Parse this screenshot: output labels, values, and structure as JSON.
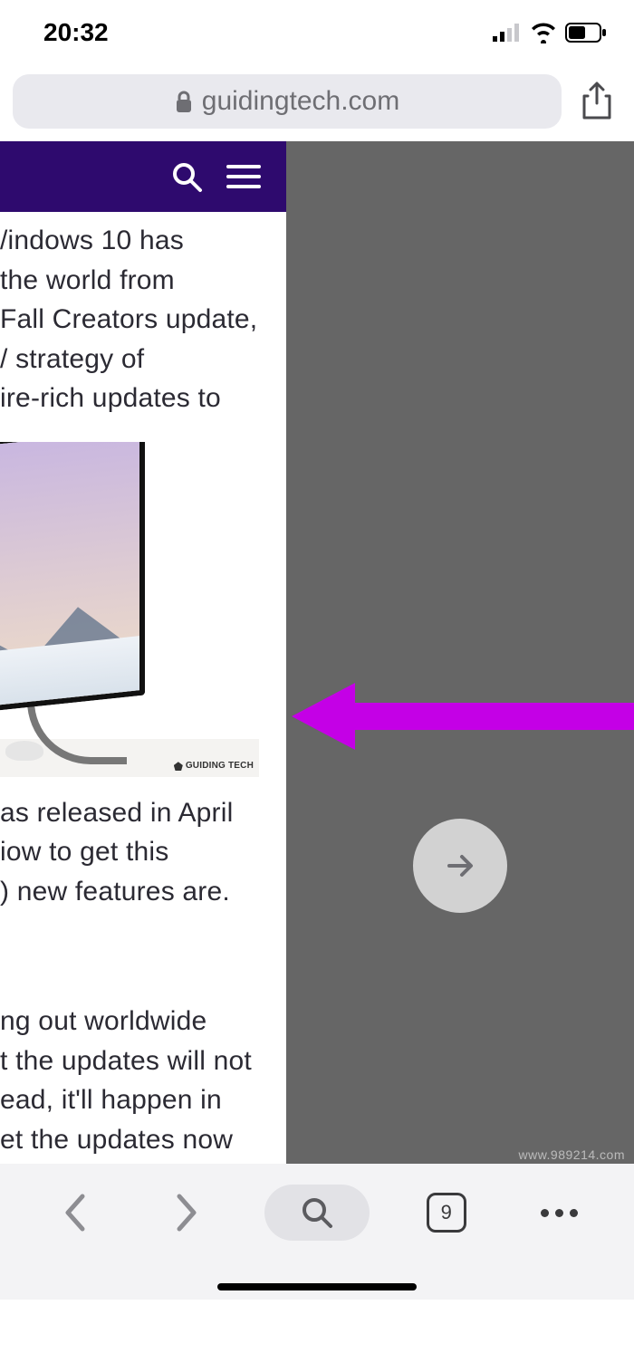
{
  "status": {
    "time": "20:32"
  },
  "address": {
    "domain": "guidingtech.com"
  },
  "article": {
    "p1_l1": "/indows 10 has",
    "p1_l2": "the world from",
    "p1_l3": "Fall Creators update,",
    "p1_l4": "/ strategy of",
    "p1_l5": "ire-rich updates to",
    "img_watermark": "GUIDING TECH",
    "p2_l1": "as released in April",
    "p2_l2": "iow to get this",
    "p2_l3": ") new features are.",
    "p3_l1": "ng out worldwide",
    "p3_l2": "t the updates will not",
    "p3_l3": "ead, it'll happen in",
    "p3_l4": "et the updates now"
  },
  "toolbar": {
    "tab_count": "9"
  },
  "watermark": "www.989214.com"
}
